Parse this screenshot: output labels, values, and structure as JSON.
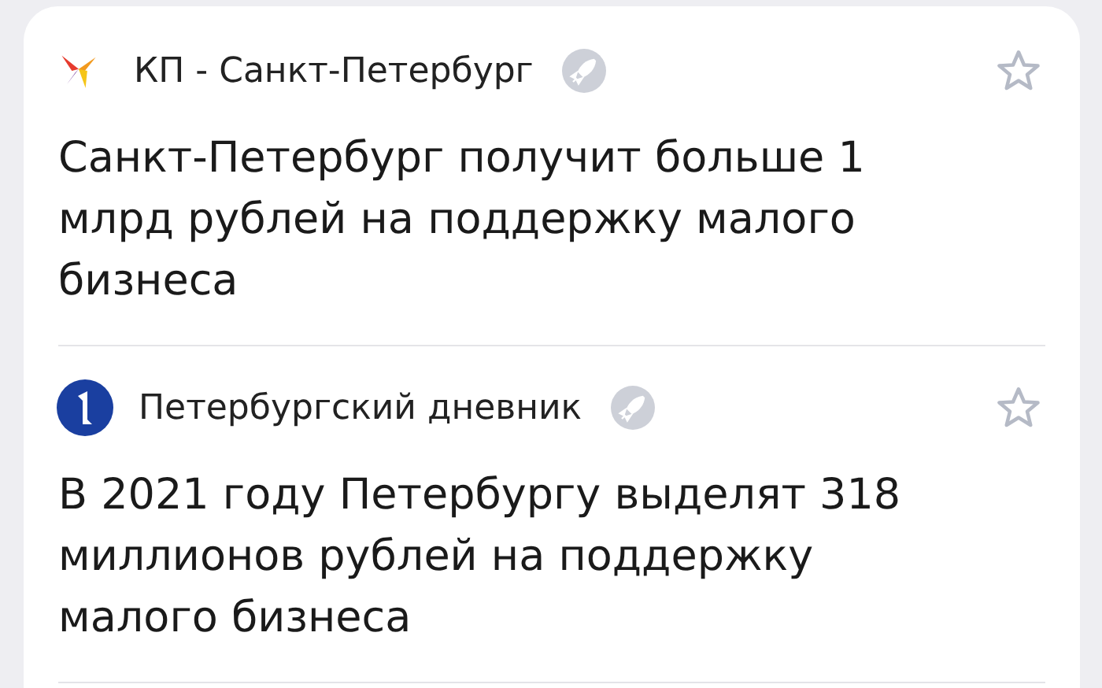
{
  "news": [
    {
      "source": "КП - Санкт-Петербург",
      "kind": "bird",
      "headline": "Санкт-Петербург получит больше 1 млрд рублей на поддержку малого бизнеса",
      "favorite": false
    },
    {
      "source": "Петербургский дневник",
      "kind": "circle",
      "headline": "В 2021 году Петербургу выделят 318 миллионов рублей на поддержку малого бизнеса",
      "favorite": false
    }
  ]
}
